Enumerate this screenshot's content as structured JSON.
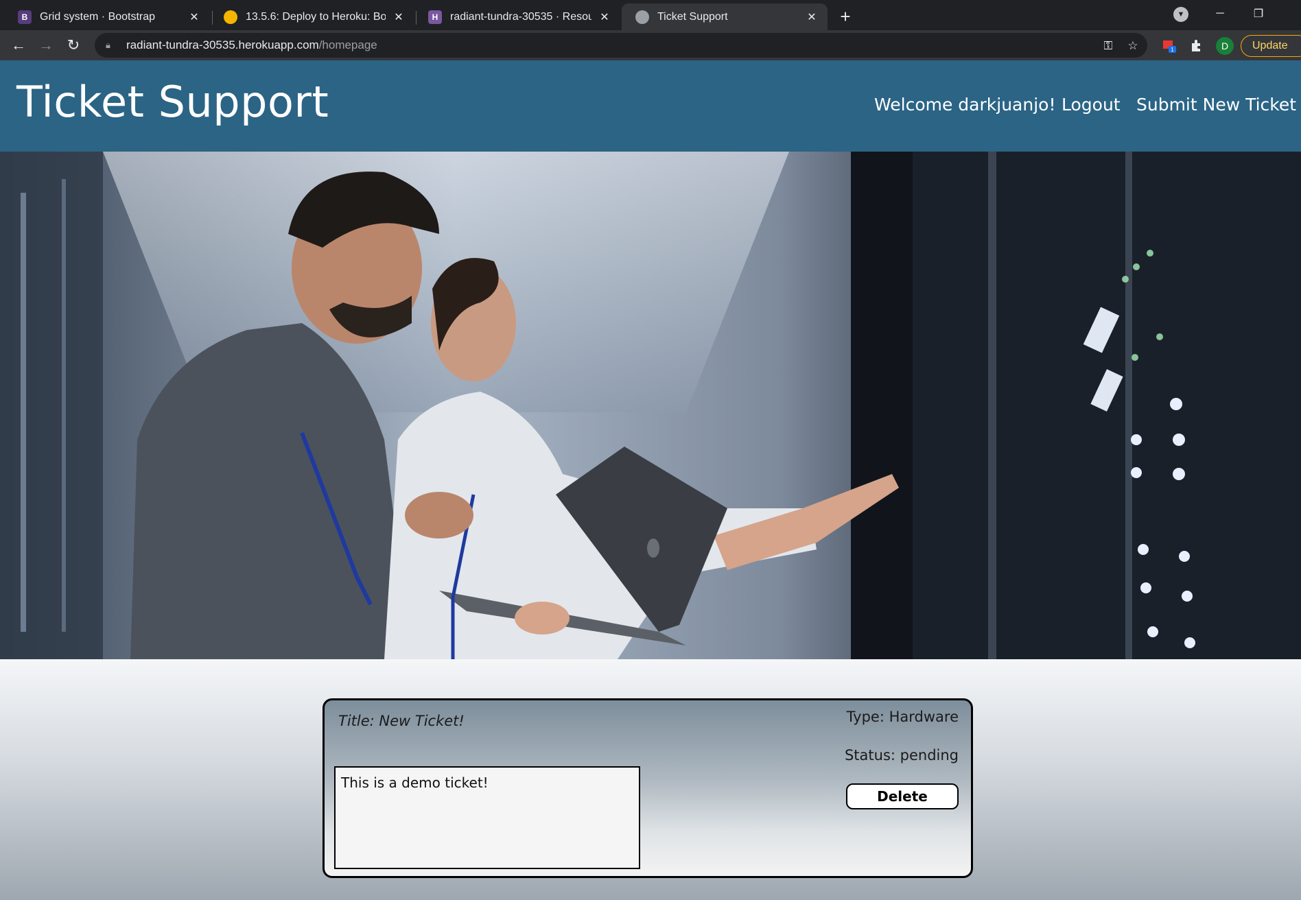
{
  "browser": {
    "tabs": [
      {
        "title": "Grid system · Bootstrap",
        "favicon": "B"
      },
      {
        "title": "13.5.6: Deploy to Heroku: Bootca",
        "favicon": ""
      },
      {
        "title": "radiant-tundra-30535 · Resources",
        "favicon": "H"
      },
      {
        "title": "Ticket Support",
        "favicon": ""
      }
    ],
    "url_host": "radiant-tundra-30535.herokuapp.com",
    "url_path": "/homepage",
    "profile_initial": "D",
    "update_label": "Update",
    "extension_badge": "1"
  },
  "site": {
    "title": "Ticket Support",
    "welcome": "Welcome darkjuanjo!",
    "logout": "Logout",
    "submit_ticket": "Submit New Ticket"
  },
  "ticket": {
    "title": "Title: New Ticket!",
    "type": "Type: Hardware",
    "status": "Status: pending",
    "description": "This is a demo ticket!",
    "delete_label": "Delete"
  },
  "colors": {
    "header": "#2b6485",
    "chrome_dark": "#202124",
    "chrome_toolbar": "#35363a"
  }
}
